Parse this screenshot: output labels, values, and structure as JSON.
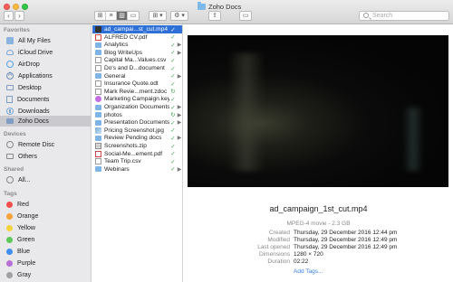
{
  "window": {
    "title": "Zoho Docs"
  },
  "toolbar": {
    "back_label": "‹",
    "forward_label": "›",
    "view_modes": [
      "⊞",
      "≡",
      "▥",
      "▭"
    ],
    "arrange_label": "⊞ ▾",
    "action_label": "⚙ ▾",
    "share_label": "⇪",
    "tags_label": "▭"
  },
  "search": {
    "placeholder": "Search"
  },
  "sidebar": {
    "favorites_header": "Favorites",
    "favorites": [
      {
        "label": "All My Files",
        "icon": "all-files-icon"
      },
      {
        "label": "iCloud Drive",
        "icon": "cloud-icon"
      },
      {
        "label": "AirDrop",
        "icon": "airdrop-icon"
      },
      {
        "label": "Applications",
        "icon": "applications-icon"
      },
      {
        "label": "Desktop",
        "icon": "desktop-icon"
      },
      {
        "label": "Documents",
        "icon": "documents-icon"
      },
      {
        "label": "Downloads",
        "icon": "downloads-icon"
      },
      {
        "label": "Zoho Docs",
        "icon": "folder-icon"
      }
    ],
    "devices_header": "Devices",
    "devices": [
      {
        "label": "Remote Disc",
        "icon": "disc-icon"
      },
      {
        "label": "Others",
        "icon": "drive-icon"
      }
    ],
    "shared_header": "Shared",
    "shared": [
      {
        "label": "All...",
        "icon": "network-icon"
      }
    ],
    "tags_header": "Tags",
    "tags": [
      {
        "label": "Red",
        "color": "#f0504a"
      },
      {
        "label": "Orange",
        "color": "#f7a23a"
      },
      {
        "label": "Yellow",
        "color": "#f5d33f"
      },
      {
        "label": "Green",
        "color": "#5cc85a"
      },
      {
        "label": "Blue",
        "color": "#3f8ff0"
      },
      {
        "label": "Purple",
        "color": "#b56fd6"
      },
      {
        "label": "Gray",
        "color": "#a0a0a0"
      }
    ]
  },
  "files": [
    {
      "name": "ad_campai...st_cut.mp4",
      "type": "video",
      "status": "✓",
      "folder": false
    },
    {
      "name": "ALFRED CV.pdf",
      "type": "pdf",
      "status": "✓",
      "folder": false
    },
    {
      "name": "Analytics",
      "type": "folder",
      "status": "✓",
      "folder": true
    },
    {
      "name": "Blog WriteUps",
      "type": "folder",
      "status": "✓",
      "folder": true
    },
    {
      "name": "Capital Ma...Values.csv",
      "type": "doc",
      "status": "✓",
      "folder": false
    },
    {
      "name": "Do's and D...document",
      "type": "doc",
      "status": "✓",
      "folder": false
    },
    {
      "name": "General",
      "type": "folder",
      "status": "✓",
      "folder": true
    },
    {
      "name": "Insurance Quote.odt",
      "type": "doc",
      "status": "✓",
      "folder": false
    },
    {
      "name": "Mark Revie...ment.zdoc",
      "type": "doc",
      "status": "↻",
      "folder": false
    },
    {
      "name": "Marketing Campaign.key",
      "type": "app",
      "status": "✓",
      "folder": false
    },
    {
      "name": "Organization Documents",
      "type": "folder",
      "status": "✓",
      "folder": true
    },
    {
      "name": "photos",
      "type": "folder",
      "status": "↻",
      "folder": true
    },
    {
      "name": "Presentation Documents",
      "type": "folder",
      "status": "✓",
      "folder": true
    },
    {
      "name": "Pricing Screenshot.jpg",
      "type": "image",
      "status": "✓",
      "folder": false
    },
    {
      "name": "Review Pending docs",
      "type": "folder",
      "status": "✓",
      "folder": true
    },
    {
      "name": "Screenshots.zip",
      "type": "zip",
      "status": "✓",
      "folder": false
    },
    {
      "name": "Social-Me...ement.pdf",
      "type": "pdf",
      "status": "✓",
      "folder": false
    },
    {
      "name": "Team Trip.csv",
      "type": "doc",
      "status": "✓",
      "folder": false
    },
    {
      "name": "Webinars",
      "type": "folder",
      "status": "✓",
      "folder": true
    }
  ],
  "preview": {
    "file_name": "ad_campaign_1st_cut.mp4",
    "kind_size": "MPEG-4 movie - 2.3 GB",
    "meta": [
      {
        "key": "Created",
        "value": "Thursday, 29 December 2016 12:44 pm"
      },
      {
        "key": "Modified",
        "value": "Thursday, 29 December 2016 12:49 pm"
      },
      {
        "key": "Last opened",
        "value": "Thursday, 29 December 2016 12:49 pm"
      },
      {
        "key": "Dimensions",
        "value": "1280 × 720"
      },
      {
        "key": "Duration",
        "value": "02:22"
      }
    ],
    "add_tags": "Add Tags..."
  }
}
